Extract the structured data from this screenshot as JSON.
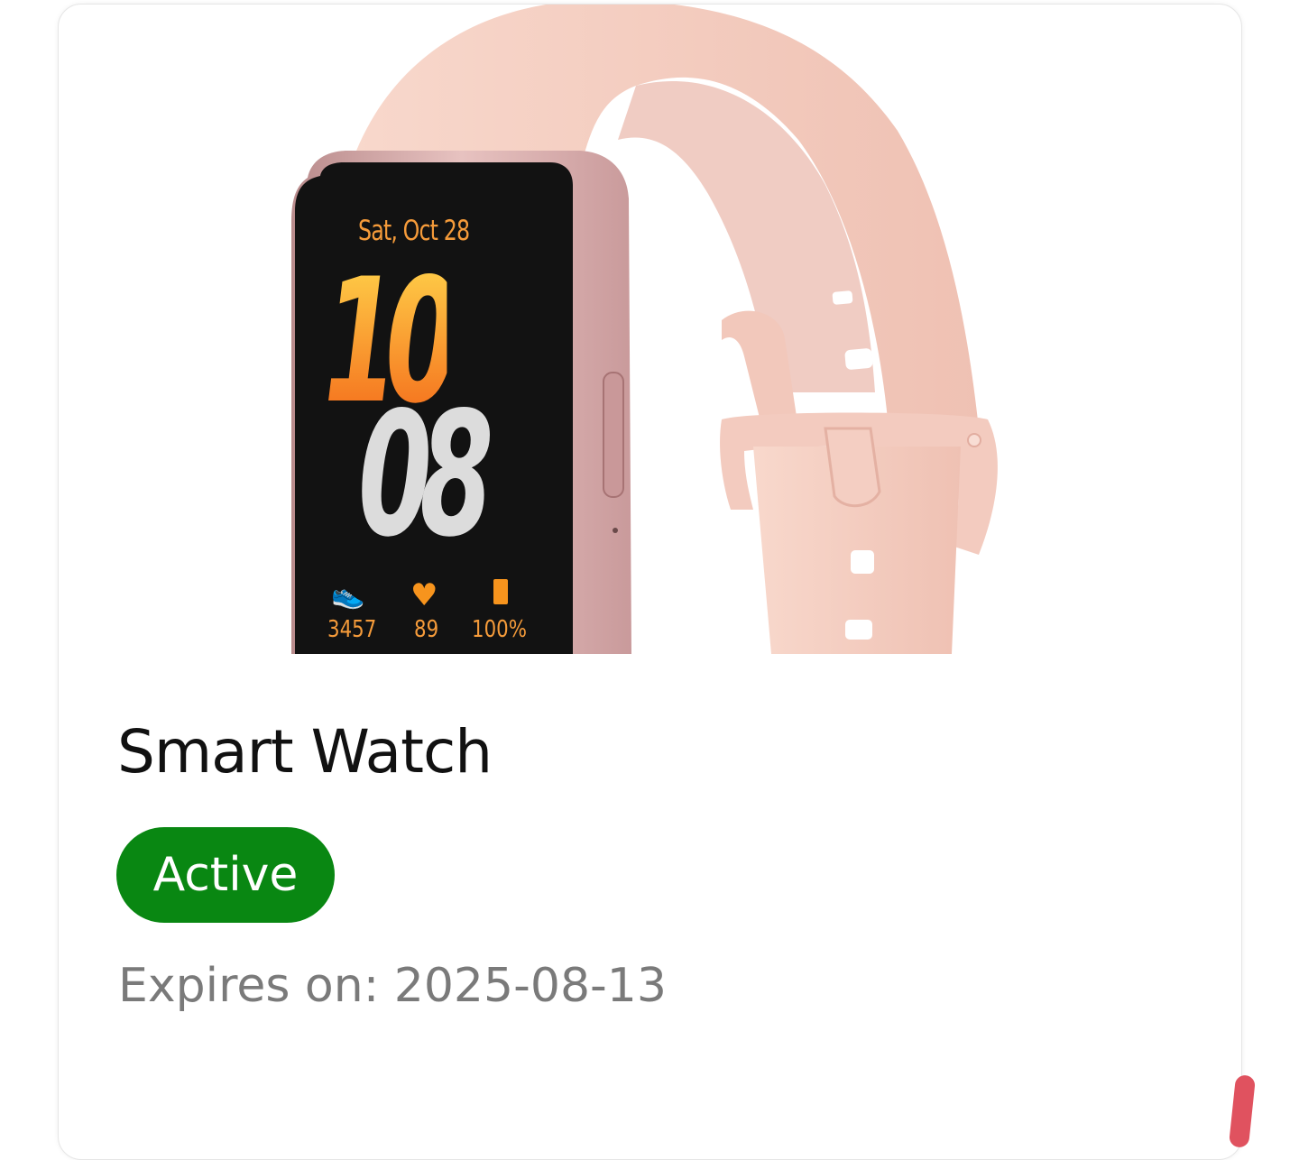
{
  "product": {
    "title": "Smart Watch",
    "status": "Active",
    "expiry_text": "Expires on: 2025-08-13"
  },
  "watch_face": {
    "date": "Sat, Oct 28",
    "hour": "10",
    "minute": "08",
    "steps": "3457",
    "heart_rate": "89",
    "battery": "100%"
  },
  "colors": {
    "status_active": "#098712",
    "band": "#f5cfc3",
    "accent_orange": "#f7941d"
  }
}
